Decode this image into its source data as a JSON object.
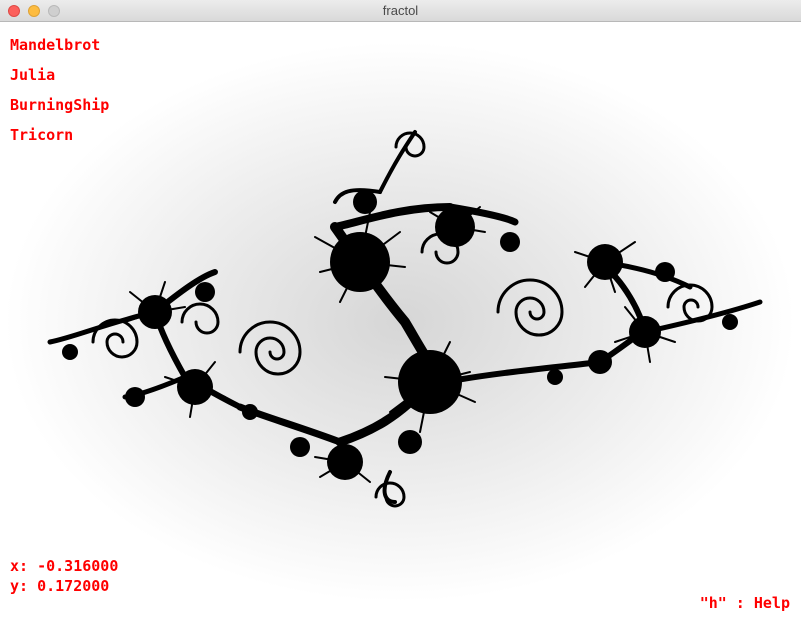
{
  "window": {
    "title": "fractol"
  },
  "menu": {
    "items": [
      {
        "label": "Mandelbrot"
      },
      {
        "label": "Julia"
      },
      {
        "label": "BurningShip"
      },
      {
        "label": "Tricorn"
      }
    ]
  },
  "coordinates": {
    "x": "x: -0.316000",
    "y": "y: 0.172000"
  },
  "help": {
    "label": "\"h\" : Help"
  },
  "colors": {
    "text": "#ff0000",
    "fractal": "#000000",
    "background": "#ffffff"
  },
  "fractal": {
    "type": "Julia",
    "c_real": -0.316,
    "c_imag": 0.172
  }
}
